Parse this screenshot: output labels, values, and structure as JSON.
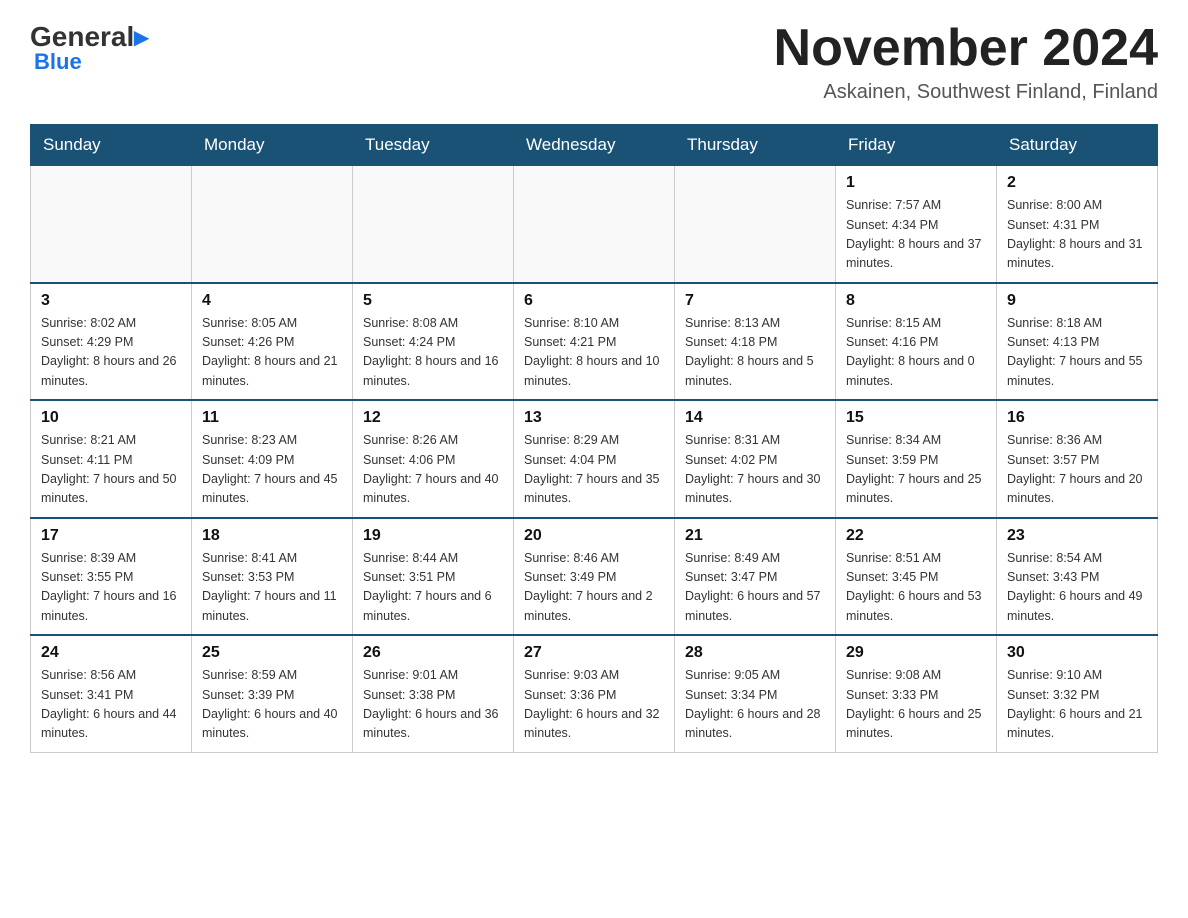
{
  "header": {
    "logo_general": "General",
    "logo_blue": "Blue",
    "month_title": "November 2024",
    "location": "Askainen, Southwest Finland, Finland"
  },
  "calendar": {
    "weekdays": [
      "Sunday",
      "Monday",
      "Tuesday",
      "Wednesday",
      "Thursday",
      "Friday",
      "Saturday"
    ],
    "weeks": [
      [
        {
          "day": "",
          "info": ""
        },
        {
          "day": "",
          "info": ""
        },
        {
          "day": "",
          "info": ""
        },
        {
          "day": "",
          "info": ""
        },
        {
          "day": "",
          "info": ""
        },
        {
          "day": "1",
          "info": "Sunrise: 7:57 AM\nSunset: 4:34 PM\nDaylight: 8 hours\nand 37 minutes."
        },
        {
          "day": "2",
          "info": "Sunrise: 8:00 AM\nSunset: 4:31 PM\nDaylight: 8 hours\nand 31 minutes."
        }
      ],
      [
        {
          "day": "3",
          "info": "Sunrise: 8:02 AM\nSunset: 4:29 PM\nDaylight: 8 hours\nand 26 minutes."
        },
        {
          "day": "4",
          "info": "Sunrise: 8:05 AM\nSunset: 4:26 PM\nDaylight: 8 hours\nand 21 minutes."
        },
        {
          "day": "5",
          "info": "Sunrise: 8:08 AM\nSunset: 4:24 PM\nDaylight: 8 hours\nand 16 minutes."
        },
        {
          "day": "6",
          "info": "Sunrise: 8:10 AM\nSunset: 4:21 PM\nDaylight: 8 hours\nand 10 minutes."
        },
        {
          "day": "7",
          "info": "Sunrise: 8:13 AM\nSunset: 4:18 PM\nDaylight: 8 hours\nand 5 minutes."
        },
        {
          "day": "8",
          "info": "Sunrise: 8:15 AM\nSunset: 4:16 PM\nDaylight: 8 hours\nand 0 minutes."
        },
        {
          "day": "9",
          "info": "Sunrise: 8:18 AM\nSunset: 4:13 PM\nDaylight: 7 hours\nand 55 minutes."
        }
      ],
      [
        {
          "day": "10",
          "info": "Sunrise: 8:21 AM\nSunset: 4:11 PM\nDaylight: 7 hours\nand 50 minutes."
        },
        {
          "day": "11",
          "info": "Sunrise: 8:23 AM\nSunset: 4:09 PM\nDaylight: 7 hours\nand 45 minutes."
        },
        {
          "day": "12",
          "info": "Sunrise: 8:26 AM\nSunset: 4:06 PM\nDaylight: 7 hours\nand 40 minutes."
        },
        {
          "day": "13",
          "info": "Sunrise: 8:29 AM\nSunset: 4:04 PM\nDaylight: 7 hours\nand 35 minutes."
        },
        {
          "day": "14",
          "info": "Sunrise: 8:31 AM\nSunset: 4:02 PM\nDaylight: 7 hours\nand 30 minutes."
        },
        {
          "day": "15",
          "info": "Sunrise: 8:34 AM\nSunset: 3:59 PM\nDaylight: 7 hours\nand 25 minutes."
        },
        {
          "day": "16",
          "info": "Sunrise: 8:36 AM\nSunset: 3:57 PM\nDaylight: 7 hours\nand 20 minutes."
        }
      ],
      [
        {
          "day": "17",
          "info": "Sunrise: 8:39 AM\nSunset: 3:55 PM\nDaylight: 7 hours\nand 16 minutes."
        },
        {
          "day": "18",
          "info": "Sunrise: 8:41 AM\nSunset: 3:53 PM\nDaylight: 7 hours\nand 11 minutes."
        },
        {
          "day": "19",
          "info": "Sunrise: 8:44 AM\nSunset: 3:51 PM\nDaylight: 7 hours\nand 6 minutes."
        },
        {
          "day": "20",
          "info": "Sunrise: 8:46 AM\nSunset: 3:49 PM\nDaylight: 7 hours\nand 2 minutes."
        },
        {
          "day": "21",
          "info": "Sunrise: 8:49 AM\nSunset: 3:47 PM\nDaylight: 6 hours\nand 57 minutes."
        },
        {
          "day": "22",
          "info": "Sunrise: 8:51 AM\nSunset: 3:45 PM\nDaylight: 6 hours\nand 53 minutes."
        },
        {
          "day": "23",
          "info": "Sunrise: 8:54 AM\nSunset: 3:43 PM\nDaylight: 6 hours\nand 49 minutes."
        }
      ],
      [
        {
          "day": "24",
          "info": "Sunrise: 8:56 AM\nSunset: 3:41 PM\nDaylight: 6 hours\nand 44 minutes."
        },
        {
          "day": "25",
          "info": "Sunrise: 8:59 AM\nSunset: 3:39 PM\nDaylight: 6 hours\nand 40 minutes."
        },
        {
          "day": "26",
          "info": "Sunrise: 9:01 AM\nSunset: 3:38 PM\nDaylight: 6 hours\nand 36 minutes."
        },
        {
          "day": "27",
          "info": "Sunrise: 9:03 AM\nSunset: 3:36 PM\nDaylight: 6 hours\nand 32 minutes."
        },
        {
          "day": "28",
          "info": "Sunrise: 9:05 AM\nSunset: 3:34 PM\nDaylight: 6 hours\nand 28 minutes."
        },
        {
          "day": "29",
          "info": "Sunrise: 9:08 AM\nSunset: 3:33 PM\nDaylight: 6 hours\nand 25 minutes."
        },
        {
          "day": "30",
          "info": "Sunrise: 9:10 AM\nSunset: 3:32 PM\nDaylight: 6 hours\nand 21 minutes."
        }
      ]
    ]
  }
}
